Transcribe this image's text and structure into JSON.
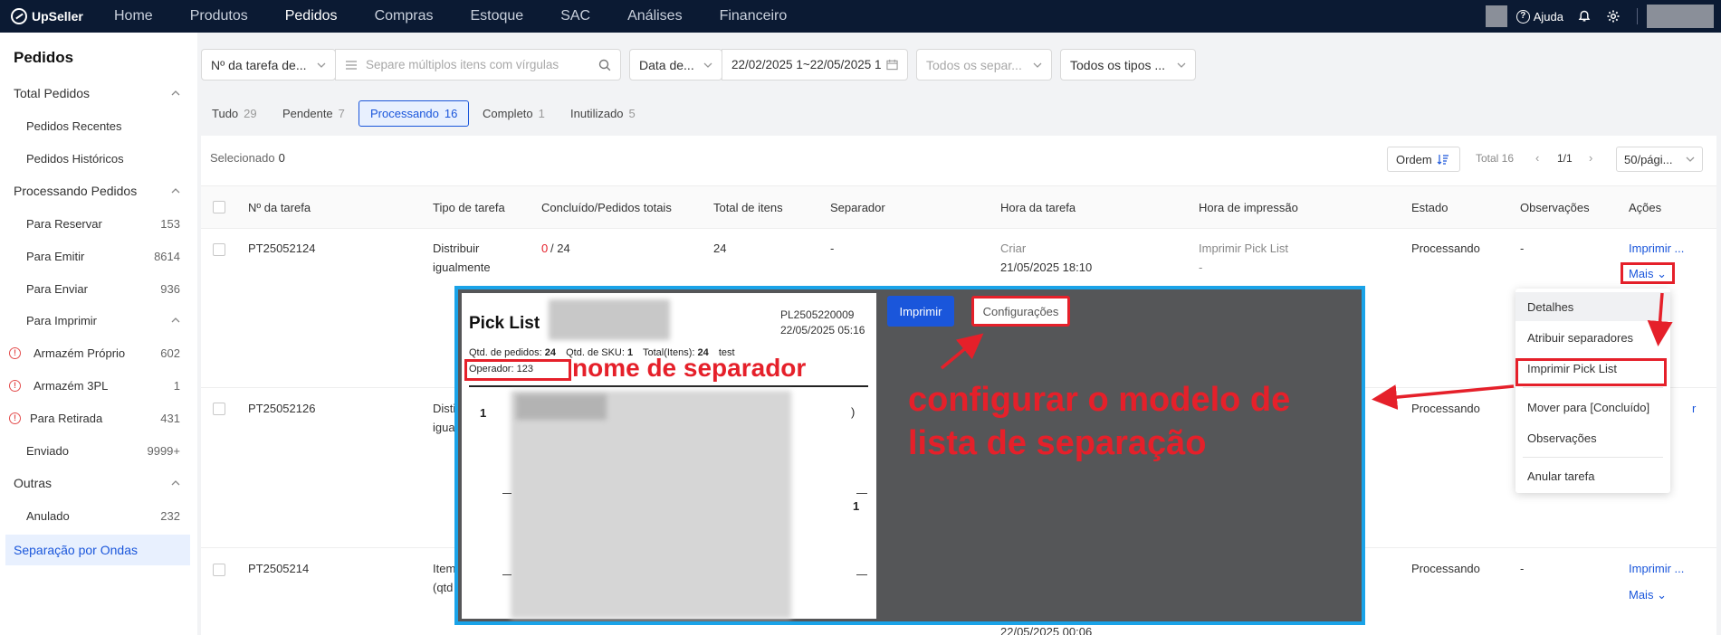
{
  "app": {
    "brand": "UpSeller"
  },
  "nav": {
    "items": [
      "Home",
      "Produtos",
      "Pedidos",
      "Compras",
      "Estoque",
      "SAC",
      "Análises",
      "Financeiro"
    ],
    "active": "Pedidos"
  },
  "topbar": {
    "help_label": "Ajuda"
  },
  "sidebar": {
    "title": "Pedidos",
    "rows": [
      {
        "label": "Total Pedidos",
        "count": ""
      },
      {
        "label": "Pedidos Recentes",
        "count": ""
      },
      {
        "label": "Pedidos Históricos",
        "count": ""
      },
      {
        "label": "Processando Pedidos",
        "count": ""
      },
      {
        "label": "Para Reservar",
        "count": "153"
      },
      {
        "label": "Para Emitir",
        "count": "8614"
      },
      {
        "label": "Para Enviar",
        "count": "936"
      },
      {
        "label": "Para Imprimir",
        "count": ""
      },
      {
        "label": "Armazém Próprio",
        "count": "602"
      },
      {
        "label": "Armazém 3PL",
        "count": "1"
      },
      {
        "label": "Para Retirada",
        "count": "431"
      },
      {
        "label": "Enviado",
        "count": "9999+"
      },
      {
        "label": "Outras",
        "count": ""
      },
      {
        "label": "Anulado",
        "count": "232"
      },
      {
        "label": "Separação por Ondas",
        "count": ""
      }
    ]
  },
  "filters": {
    "task_number_select": "Nº da tarefa de...",
    "search_placeholder": "Separe múltiplos itens com vírgulas",
    "date_select": "Data de...",
    "date_range": "22/02/2025 1~22/05/2025 1",
    "separator_placeholder": "Todos os separ...",
    "type_select": "Todos os tipos ..."
  },
  "tabs": [
    {
      "label": "Tudo",
      "count": "29"
    },
    {
      "label": "Pendente",
      "count": "7"
    },
    {
      "label": "Processando",
      "count": "16"
    },
    {
      "label": "Completo",
      "count": "1"
    },
    {
      "label": "Inutilizado",
      "count": "5"
    }
  ],
  "toolbar": {
    "selected_label": "Selecionado",
    "selected_count": "0",
    "order_label": "Ordem",
    "total_label": "Total 16",
    "page": "1/1",
    "per_page": "50/pági..."
  },
  "table": {
    "headers": [
      "Nº da tarefa",
      "Tipo de tarefa",
      "Concluído/Pedidos totais",
      "Total de itens",
      "Separador",
      "Hora da tarefa",
      "Hora de impressão",
      "Estado",
      "Observações",
      "Ações"
    ],
    "rows": [
      {
        "id": "PT25052124",
        "type_l1": "Distribuir",
        "type_l2": "igualmente",
        "done": "0",
        "total": "/ 24",
        "items": "24",
        "separator": "-",
        "time_label": "Criar",
        "time": "21/05/2025 18:10",
        "print_label": "Imprimir Pick List",
        "print_time": "-",
        "status": "Processando",
        "notes": "-",
        "action": "Imprimir ...",
        "more": "Mais"
      },
      {
        "id": "PT25052126",
        "type_l1": "Disti",
        "type_l2": "igua",
        "status": "Processando",
        "action": "r"
      },
      {
        "id": "PT2505214",
        "type_l1": "Item",
        "type_l2": "(qtd",
        "time": "22/05/2025 00:06",
        "status": "Processando",
        "notes": "-",
        "action": "Imprimir ...",
        "more": "Mais"
      }
    ]
  },
  "dropdown": {
    "items": [
      "Detalhes",
      "Atribuir separadores",
      "Imprimir Pick List",
      "Mover para [Concluído]",
      "Observações",
      "Anular tarefa"
    ]
  },
  "picklist": {
    "title": "Pick List",
    "code": "PL2505220009",
    "date": "22/05/2025 05:16",
    "orders_label": "Qtd. de pedidos:",
    "orders_value": "24",
    "sku_label": "Qtd. de SKU:",
    "sku_value": "1",
    "items_label": "Total(Itens):",
    "items_value": "24",
    "extra": "test",
    "operator_label": "Operador: 123",
    "row1_num": "1",
    "row2_num": "1",
    "paren": ")",
    "print_button": "Imprimir",
    "config_button": "Configurações"
  },
  "annotations": {
    "separator_name": "nome de separador",
    "configure_template": "configurar o modelo de lista de separação"
  },
  "colors": {
    "accent": "#1a56db",
    "annotation": "#e5202a",
    "overlay_border": "#1aa3e8",
    "topbar": "#0b1a33"
  }
}
